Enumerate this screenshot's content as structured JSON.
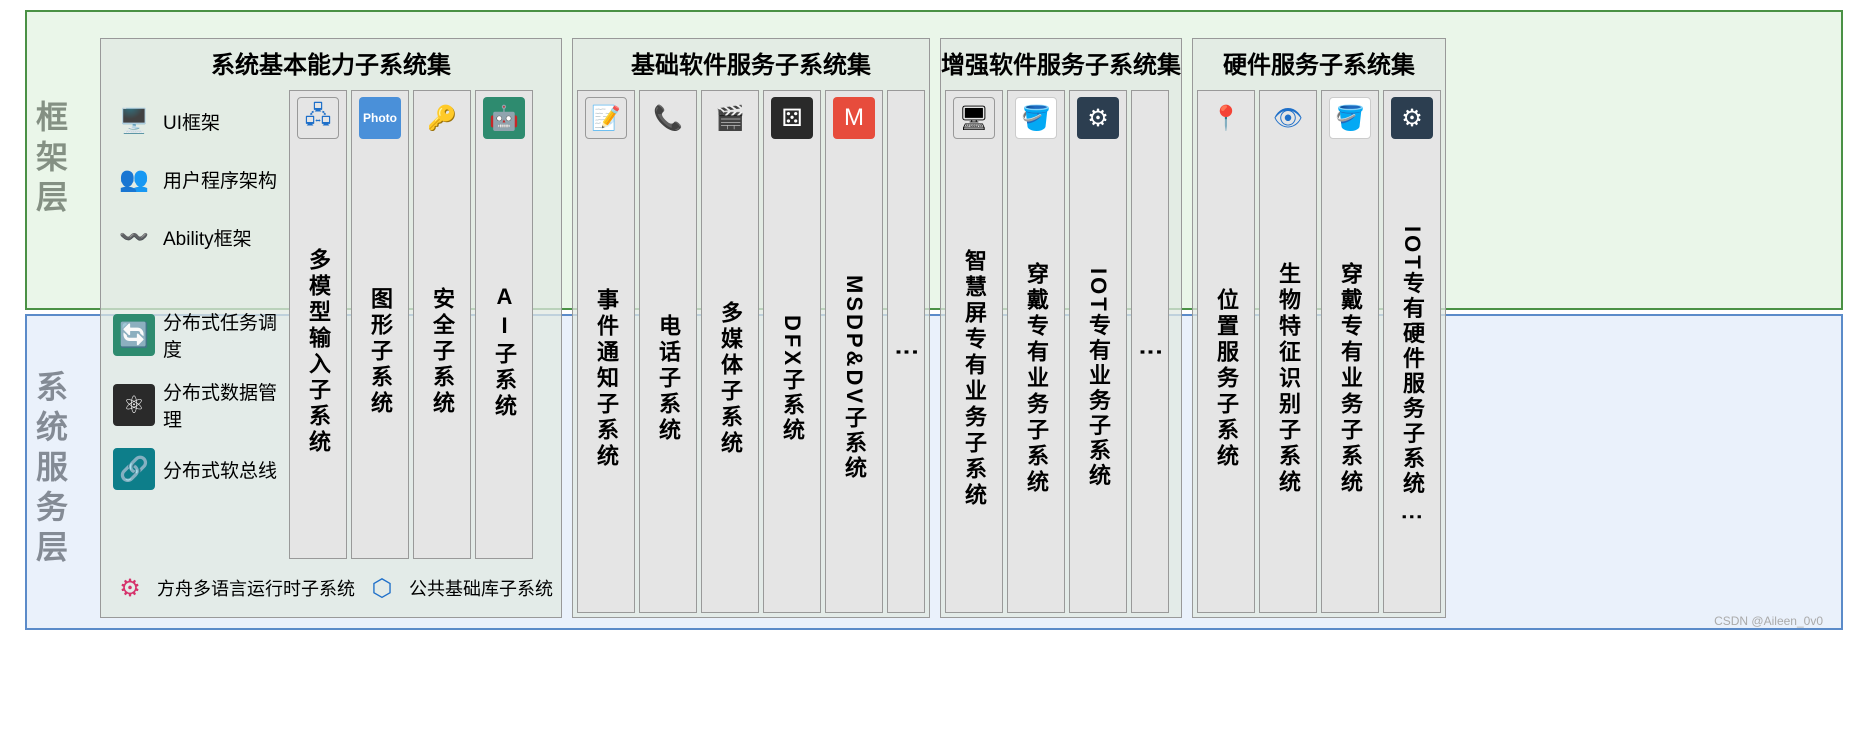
{
  "side": {
    "top": "框架层",
    "bottom": "系统服务层"
  },
  "groups": {
    "g1": {
      "title": "系统基本能力子系统集",
      "left_top": [
        {
          "label": "UI框架",
          "icon": "🖥️"
        },
        {
          "label": "用户程序架构",
          "icon": "👥"
        },
        {
          "label": "Ability框架",
          "icon": "〰️"
        }
      ],
      "left_bottom": [
        {
          "label": "分布式任务调度",
          "icon": "🔄"
        },
        {
          "label": "分布式数据管理",
          "icon": "⚛"
        },
        {
          "label": "分布式软总线",
          "icon": "🔗"
        }
      ],
      "bottom_row": [
        {
          "label": "方舟多语言运行时子系统",
          "icon": "⚙"
        },
        {
          "label": "公共基础库子系统",
          "icon": "⬡"
        }
      ],
      "cols": [
        {
          "label": "多模型输入子系统",
          "icon": "🖧",
          "iconClass": "ic-outline ic-blue"
        },
        {
          "label": "图形子系统",
          "icon": "Photo",
          "iconClass": "ic-lightblue"
        },
        {
          "label": "安全子系统",
          "icon": "🔑",
          "iconClass": "ic-blue"
        },
        {
          "label": "AI子系统",
          "icon": "🤖",
          "iconClass": "ic-green"
        }
      ]
    },
    "g2": {
      "title": "基础软件服务子系统集",
      "cols": [
        {
          "label": "事件通知子系统",
          "icon": "📝",
          "iconClass": "ic-outline"
        },
        {
          "label": "电话子系统",
          "icon": "📞",
          "iconClass": ""
        },
        {
          "label": "多媒体子系统",
          "icon": "🎬",
          "iconClass": "ic-blue"
        },
        {
          "label": "DFX子系统",
          "icon": "⚄",
          "iconClass": "ic-dark",
          "mixed": true
        },
        {
          "label": "MSDP&DV子系统",
          "icon": "M",
          "iconClass": "ic-red",
          "mixed": true
        }
      ],
      "ellipsis": "⋮"
    },
    "g3": {
      "title": "增强软件服务子系统集",
      "cols": [
        {
          "label": "智慧屏专有业务子系统",
          "icon": "🖥",
          "iconClass": "ic-outline"
        },
        {
          "label": "穿戴专有业务子系统",
          "icon": "🪣",
          "iconClass": "ic-white"
        },
        {
          "label": "IOT专有业务子系统",
          "icon": "⚙",
          "iconClass": "ic-navy",
          "mixed": true
        }
      ],
      "ellipsis": "⋮"
    },
    "g4": {
      "title": "硬件服务子系统集",
      "cols": [
        {
          "label": "位置服务子系统",
          "icon": "📍",
          "iconClass": "ic-blue"
        },
        {
          "label": "生物特征识别子系统",
          "icon": "👁",
          "iconClass": "ic-blue"
        },
        {
          "label": "穿戴专有业务子系统",
          "icon": "🪣",
          "iconClass": "ic-white"
        },
        {
          "label": "IOT专有硬件服务子系统",
          "icon": "⚙",
          "iconClass": "ic-navy",
          "mixed": true,
          "extraEllipsis": true
        }
      ]
    }
  },
  "watermark": "CSDN @Aileen_0v0"
}
